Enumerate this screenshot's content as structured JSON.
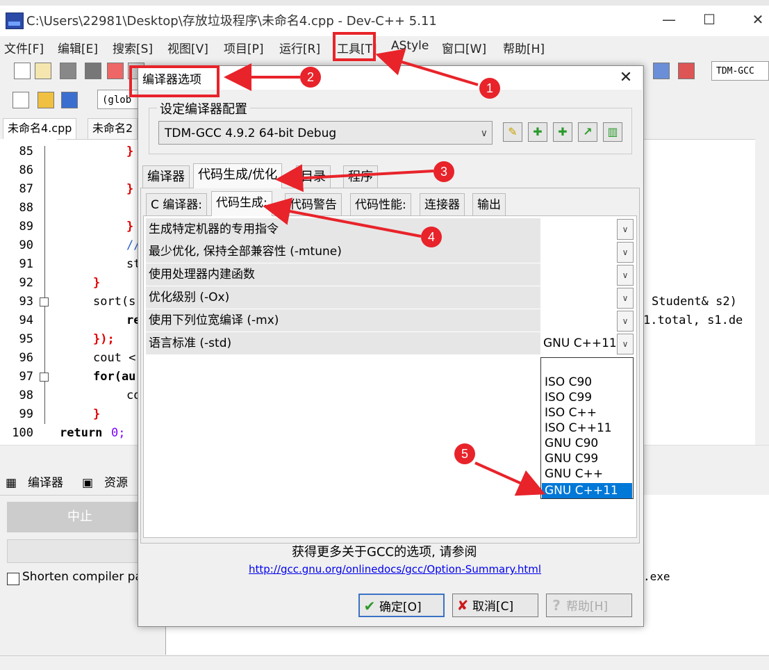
{
  "window": {
    "title": "C:\\Users\\22981\\Desktop\\存放垃圾程序\\未命名4.cpp - Dev-C++ 5.11",
    "minimize": "—",
    "maximize": "☐",
    "close": "✕"
  },
  "menu": {
    "items": [
      "文件[F]",
      "编辑[E]",
      "搜索[S]",
      "视图[V]",
      "项目[P]",
      "运行[R]",
      "工具[T]",
      "AStyle",
      "窗口[W]",
      "帮助[H]"
    ]
  },
  "toolbar": {
    "compiler_box": "TDM-GCC",
    "scope_box": "(glob"
  },
  "editor": {
    "tabs": [
      "未命名4.cpp",
      "未命名2"
    ],
    "line_numbers": [
      "85",
      "86",
      "87",
      "88",
      "89",
      "90",
      "91",
      "92",
      "93",
      "94",
      "95",
      "96",
      "97",
      "98",
      "99",
      "100"
    ],
    "code": {
      "l85": "}",
      "l87": "}",
      "l89": "}",
      "l90": "//",
      "l91": "st",
      "l92": "}",
      "l93a": "sort(s",
      "l93b": "Student& s2)",
      "l94a": "re",
      "l94b": "1.total, s1.de",
      "l95": "});",
      "l96": "cout <",
      "l97": "for(au",
      "l98": "co",
      "l99": "}",
      "l100a": "return",
      "l100b": "0;"
    }
  },
  "bottom": {
    "tab_compiler": "编译器",
    "tab_resources": "资源",
    "abort": "中止",
    "shorten_label": "Shorten compiler pat",
    "output_fragment": ".exe"
  },
  "dialog": {
    "title": "编译器选项",
    "config_group_label": "设定编译器配置",
    "compiler_selected": "TDM-GCC 4.9.2 64-bit Debug",
    "tabs": [
      "编译器",
      "代码生成/优化",
      "目录",
      "程序"
    ],
    "subtabs": [
      "C 编译器:",
      "代码生成:",
      "代码警告",
      "代码性能:",
      "连接器",
      "输出"
    ],
    "options": [
      {
        "label": "生成特定机器的专用指令",
        "value": ""
      },
      {
        "label": "最少优化, 保持全部兼容性 (-mtune)",
        "value": ""
      },
      {
        "label": "使用处理器内建函数",
        "value": ""
      },
      {
        "label": "优化级别 (-Ox)",
        "value": ""
      },
      {
        "label": "使用下列位宽编译 (-mx)",
        "value": ""
      },
      {
        "label": "语言标准 (-std)",
        "value": "GNU C++11"
      }
    ],
    "std_options": [
      "",
      "ISO C90",
      "ISO C99",
      "ISO C++",
      "ISO C++11",
      "GNU C90",
      "GNU C99",
      "GNU C++",
      "GNU C++11"
    ],
    "std_selected_index": 8,
    "more_info": "获得更多关于GCC的选项, 请参阅",
    "link": "http://gcc.gnu.org/onlinedocs/gcc/Option-Summary.html",
    "ok": "确定[O]",
    "cancel": "取消[C]",
    "help": "帮助[H]"
  },
  "annotations": {
    "badges": [
      "1",
      "2",
      "3",
      "4",
      "5"
    ],
    "color": "#e8232a"
  }
}
